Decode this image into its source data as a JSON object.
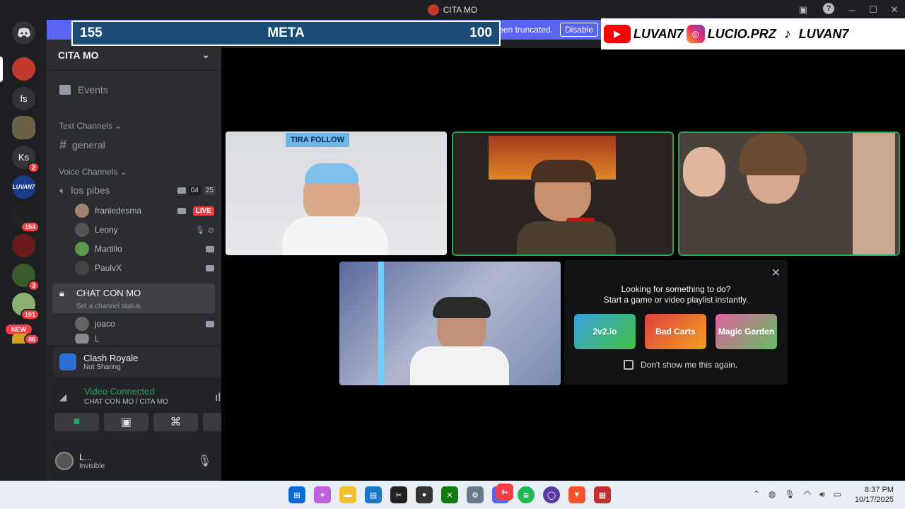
{
  "window": {
    "title": "CITA MO"
  },
  "banner": {
    "text": "been truncated.",
    "disable_label": "Disable"
  },
  "overlay": {
    "left_value": "155",
    "title": "META",
    "right_value": "100"
  },
  "socials": {
    "youtube": "LUVAN7",
    "instagram": "LUCIO.PRZ",
    "tiktok": "LUVAN7"
  },
  "server_list": {
    "items": [
      {
        "label": "fs"
      },
      {
        "label": "Ks",
        "badge": "2"
      },
      {
        "label": "LUVAN7"
      },
      {
        "badge": "154"
      },
      {
        "badge": "3"
      },
      {
        "badge": "101"
      },
      {
        "new_label": "NEW",
        "badge": "86"
      }
    ]
  },
  "sidebar": {
    "server_name": "CITA MO",
    "events_label": "Events",
    "text_channels_label": "Text Channels",
    "general_label": "general",
    "voice_channels_label": "Voice Channels",
    "voice1": {
      "name": "los pibes",
      "count": "04",
      "limit": "25"
    },
    "users1": [
      {
        "name": "franledesma",
        "live": "LIVE"
      },
      {
        "name": "Leony"
      },
      {
        "name": "Martillo"
      },
      {
        "name": "PaulvX"
      }
    ],
    "voice2": {
      "name": "CHAT CON MO",
      "status": "Set a channel status"
    },
    "users2": [
      {
        "name": "joaco"
      },
      {
        "name": "L"
      }
    ]
  },
  "activity": {
    "game": "Clash Royale",
    "status": "Not Sharing"
  },
  "voice_connection": {
    "status": "Video Connected",
    "location": "CHAT CON MO / CITA MO"
  },
  "user_panel": {
    "name": "L...",
    "status": "Invisible"
  },
  "promo": {
    "line1": "Looking for something to do?",
    "line2": "Start a game or video playlist instantly.",
    "games": [
      "2v2.io",
      "Bad Carts",
      "Magic Garden"
    ],
    "dont_show": "Don't show me this again."
  },
  "tiles": {
    "banner_text": "TIRA FOLLOW"
  },
  "taskbar": {
    "time": "8:37 PM",
    "date": "10/17/2025",
    "discord_badge": "9+"
  },
  "colors": {
    "accent": "#5865f2",
    "live": "#f23f43",
    "connected": "#23a55a",
    "overlay": "#1b4c75"
  }
}
